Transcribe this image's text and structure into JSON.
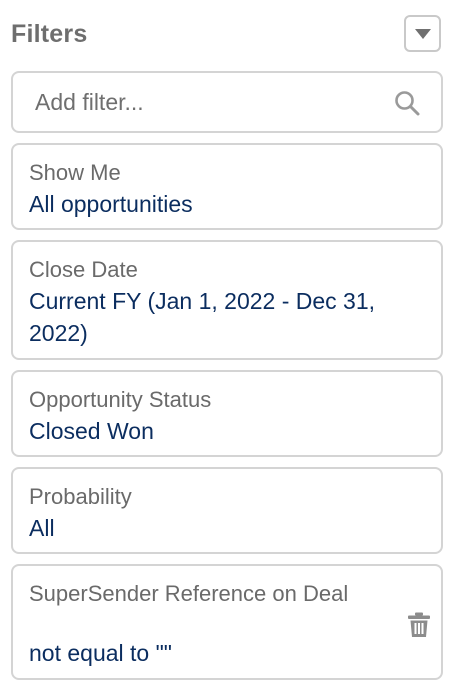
{
  "header": {
    "title": "Filters",
    "menu_icon": "chevron-down-icon"
  },
  "search": {
    "placeholder": "Add filter...",
    "value": "",
    "icon": "search-icon"
  },
  "filters": [
    {
      "label": "Show Me",
      "value": "All opportunities"
    },
    {
      "label": "Close Date",
      "value": "Current FY (Jan 1, 2022 - Dec 31, 2022)"
    },
    {
      "label": "Opportunity Status",
      "value": "Closed Won"
    },
    {
      "label": "Probability",
      "value": "All"
    },
    {
      "label": "SuperSender Reference on Deal",
      "value": "not equal to \"\"",
      "remove_icon": "trash-icon"
    }
  ],
  "colors": {
    "title": "#6e6e6e",
    "label": "#6a6a6a",
    "value": "#0b2d5f",
    "border": "#d4d4d4",
    "icon": "#8c8c8c"
  }
}
